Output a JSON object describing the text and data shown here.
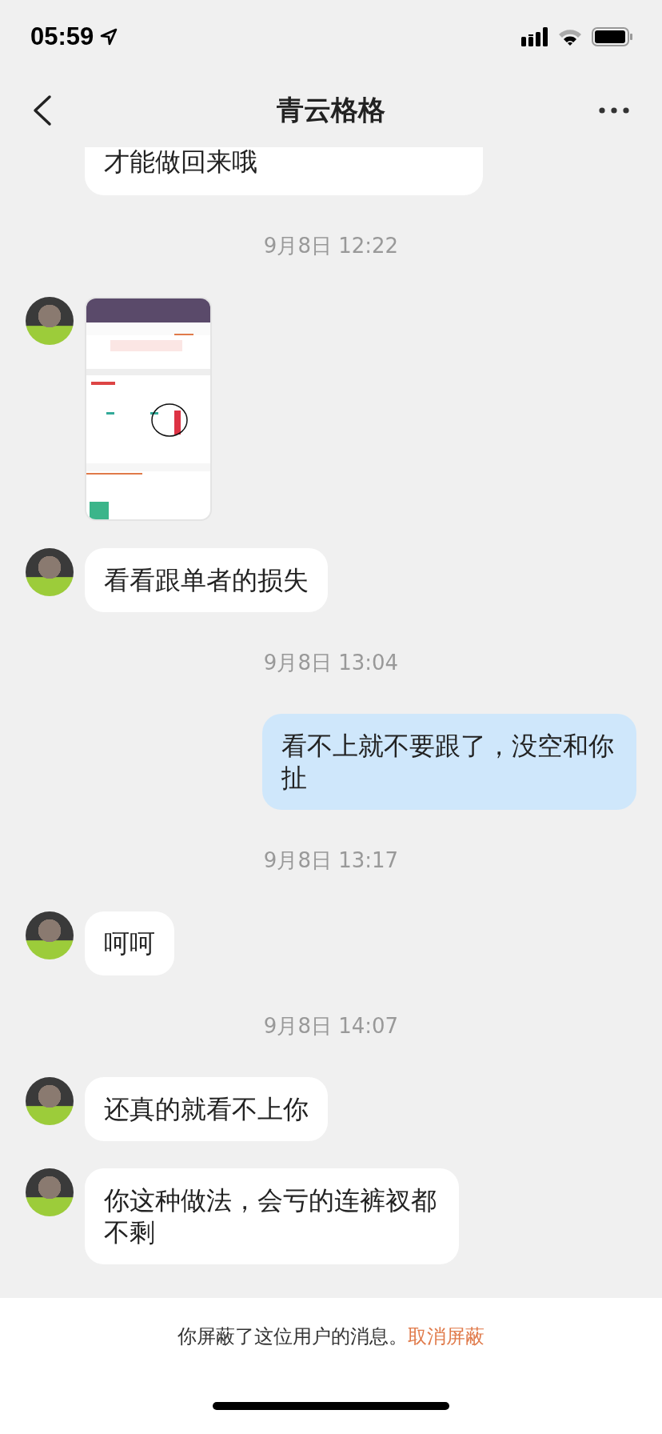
{
  "status_bar": {
    "time": "05:59"
  },
  "header": {
    "title": "青云格格"
  },
  "messages": [
    {
      "kind": "partial",
      "text": "才能做回来哦"
    },
    {
      "kind": "time",
      "text": "9月8日 12:22"
    },
    {
      "kind": "image"
    },
    {
      "kind": "incoming",
      "text": "看看跟单者的损失"
    },
    {
      "kind": "time",
      "text": "9月8日 13:04"
    },
    {
      "kind": "outgoing",
      "text": "看不上就不要跟了，没空和你扯"
    },
    {
      "kind": "time",
      "text": "9月8日 13:17"
    },
    {
      "kind": "incoming",
      "text": "呵呵"
    },
    {
      "kind": "time",
      "text": "9月8日 14:07"
    },
    {
      "kind": "incoming",
      "text": "还真的就看不上你"
    },
    {
      "kind": "incoming",
      "text": "你这种做法，会亏的连裤衩都不剩"
    }
  ],
  "footer": {
    "notice": "你屏蔽了这位用户的消息。",
    "action": "取消屏蔽"
  }
}
